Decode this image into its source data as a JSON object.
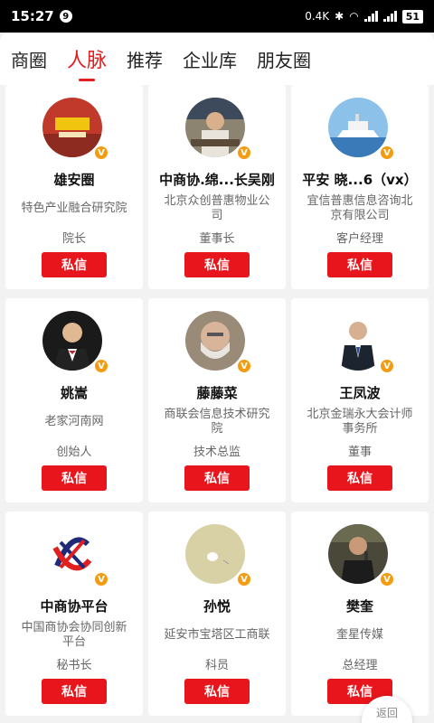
{
  "status": {
    "time": "15:27",
    "notif": "9",
    "speed": "0.4K",
    "battery": "51"
  },
  "tabs": [
    {
      "label": "商圈"
    },
    {
      "label": "人脉"
    },
    {
      "label": "推荐"
    },
    {
      "label": "企业库"
    },
    {
      "label": "朋友圈"
    }
  ],
  "contacts": [
    {
      "name": "雄安圈",
      "company": "特色产业融合研究院",
      "title": "院长",
      "avatar_color": "#c0392b"
    },
    {
      "name": "中商协.绵...长吴刚",
      "company": "北京众创普惠物业公司",
      "title": "董事长",
      "avatar_color": "#7a7060"
    },
    {
      "name": "平安 晓...6（vx）",
      "company": "宜信普惠信息咨询北京有限公司",
      "title": "客户经理",
      "avatar_color": "#6fa8d6"
    },
    {
      "name": "姚嵩",
      "company": "老家河南网",
      "title": "创始人",
      "avatar_color": "#222222"
    },
    {
      "name": "藤藤菜",
      "company": "商联会信息技术研究院",
      "title": "技术总监",
      "avatar_color": "#8a7a6a"
    },
    {
      "name": "王凤波",
      "company": "北京金瑞永大会计师事务所",
      "title": "董事",
      "avatar_color": "#2c3e50"
    },
    {
      "name": "中商协平台",
      "company": "中国商协会协同创新平台",
      "title": "秘书长",
      "avatar_color": "#ffffff"
    },
    {
      "name": "孙悦",
      "company": "延安市宝塔区工商联",
      "title": "科员",
      "avatar_color": "#d8d0a8"
    },
    {
      "name": "樊奎",
      "company": "奎星传媒",
      "title": "总经理",
      "avatar_color": "#4a4a3a"
    }
  ],
  "labels": {
    "message": "私信",
    "v": "V",
    "back_top": "返回"
  }
}
